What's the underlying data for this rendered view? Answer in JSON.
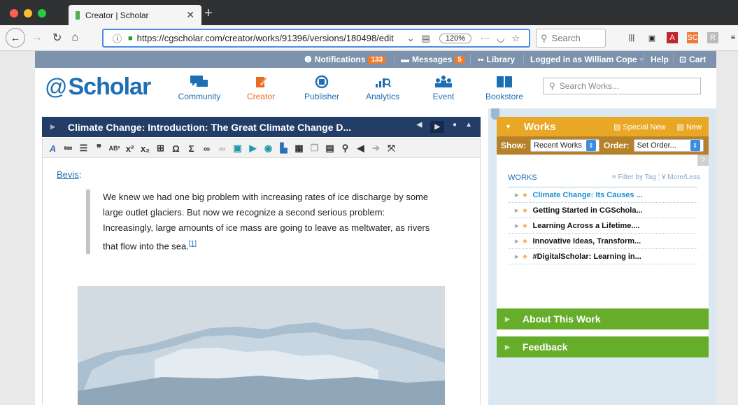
{
  "browser": {
    "tab_title": "Creator | Scholar",
    "url": "https://cgscholar.com/creator/works/91396/versions/180498/edit",
    "zoom": "120%",
    "search_placeholder": "Search",
    "more_glyph": "···"
  },
  "topbar": {
    "notifications_label": "Notifications",
    "notifications_count": "133",
    "messages_label": "Messages",
    "messages_count": "5",
    "library_label": "Library",
    "logged_in": "Logged in as William Cope",
    "help": "Help",
    "cart": "Cart"
  },
  "header": {
    "logo": "Scholar",
    "nav": [
      {
        "label": "Community"
      },
      {
        "label": "Creator"
      },
      {
        "label": "Publisher"
      },
      {
        "label": "Analytics"
      },
      {
        "label": "Event"
      },
      {
        "label": "Bookstore"
      }
    ],
    "search_placeholder": "Search Works..."
  },
  "editor": {
    "title": "Climate Change: Introduction: The Great Climate Change D...",
    "bevis_link": "Bevis",
    "bevis_suffix": ":",
    "quote_text": "We knew we had one big problem with increasing rates of ice discharge by some large outlet glaciers. But now we recognize a second serious problem: Increasingly, large amounts of ice mass are going to leave as meltwater, as rivers that flow into the sea.",
    "footnote": "[1]"
  },
  "sidebar": {
    "works_title": "Works",
    "special_new": "Special New",
    "new": "New",
    "show_label": "Show:",
    "show_value": "Recent Works",
    "order_label": "Order:",
    "order_value": "Set Order...",
    "help_mark": "?",
    "works_label": "WORKS",
    "filter_by_tag": "≡ Filter by Tag",
    "more_less": "¥ More/Less",
    "items": [
      {
        "label": "Climate Change: Its Causes ..."
      },
      {
        "label": "Getting Started in CGSchola..."
      },
      {
        "label": "Learning Across a Lifetime...."
      },
      {
        "label": "Innovative Ideas, Transform..."
      },
      {
        "label": "#DigitalScholar: Learning in..."
      }
    ],
    "about": "About This Work",
    "feedback": "Feedback"
  },
  "colors": {
    "brand_blue": "#1d6fb4",
    "creator_orange": "#ea6b1f",
    "works_gold": "#e8a826",
    "green": "#66ad2a",
    "title_navy": "#223d68"
  }
}
